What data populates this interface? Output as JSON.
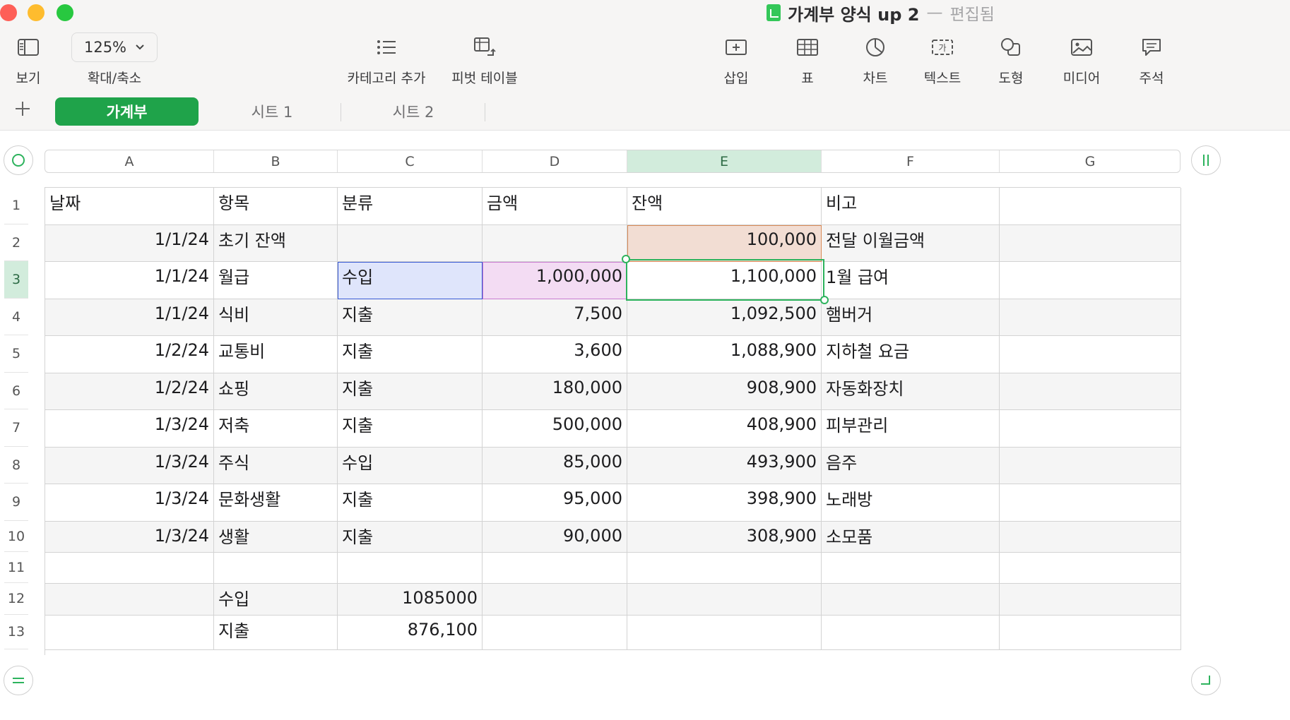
{
  "window": {
    "title": "가계부 양식 up 2",
    "title_separator": "—",
    "state": "편집됨"
  },
  "toolbar": {
    "view_label": "보기",
    "zoom_value": "125%",
    "zoom_label": "확대/축소",
    "add_category_label": "카테고리 추가",
    "pivot_label": "피벗 테이블",
    "insert_label": "삽입",
    "table_label": "표",
    "chart_label": "차트",
    "text_label": "텍스트",
    "shape_label": "도형",
    "media_label": "미디어",
    "comment_label": "주석"
  },
  "sheets": {
    "tabs": [
      {
        "label": "가계부",
        "active": true
      },
      {
        "label": "시트 1",
        "active": false
      },
      {
        "label": "시트 2",
        "active": false
      }
    ]
  },
  "grid": {
    "columns": [
      "A",
      "B",
      "C",
      "D",
      "E",
      "F",
      "G"
    ],
    "selected_column": "E",
    "rows": [
      "1",
      "2",
      "3",
      "4",
      "5",
      "6",
      "7",
      "8",
      "9",
      "10",
      "11",
      "12",
      "13"
    ],
    "selected_row": "3",
    "cells": [
      [
        "날짜",
        "항목",
        "분류",
        "금액",
        "잔액",
        "비고",
        ""
      ],
      [
        "1/1/24",
        "초기 잔액",
        "",
        "",
        "100,000",
        "전달 이월금액",
        ""
      ],
      [
        "1/1/24",
        "월급",
        "수입",
        "1,000,000",
        "1,100,000",
        "1월 급여",
        ""
      ],
      [
        "1/1/24",
        "식비",
        "지출",
        "7,500",
        "1,092,500",
        "햄버거",
        ""
      ],
      [
        "1/2/24",
        "교통비",
        "지출",
        "3,600",
        "1,088,900",
        "지하철 요금",
        ""
      ],
      [
        "1/2/24",
        "쇼핑",
        "지출",
        "180,000",
        "908,900",
        "자동화장치",
        ""
      ],
      [
        "1/3/24",
        "저축",
        "지출",
        "500,000",
        "408,900",
        "피부관리",
        ""
      ],
      [
        "1/3/24",
        "주식",
        "수입",
        "85,000",
        "493,900",
        "음주",
        ""
      ],
      [
        "1/3/24",
        "문화생활",
        "지출",
        "95,000",
        "398,900",
        "노래방",
        ""
      ],
      [
        "1/3/24",
        "생활",
        "지출",
        "90,000",
        "308,900",
        "소모품",
        ""
      ],
      [
        "",
        "",
        "",
        "",
        "",
        "",
        ""
      ],
      [
        "",
        "수입",
        "1085000",
        "",
        "",
        "",
        ""
      ],
      [
        "",
        "지출",
        "876,100",
        "",
        "",
        "",
        ""
      ]
    ]
  }
}
